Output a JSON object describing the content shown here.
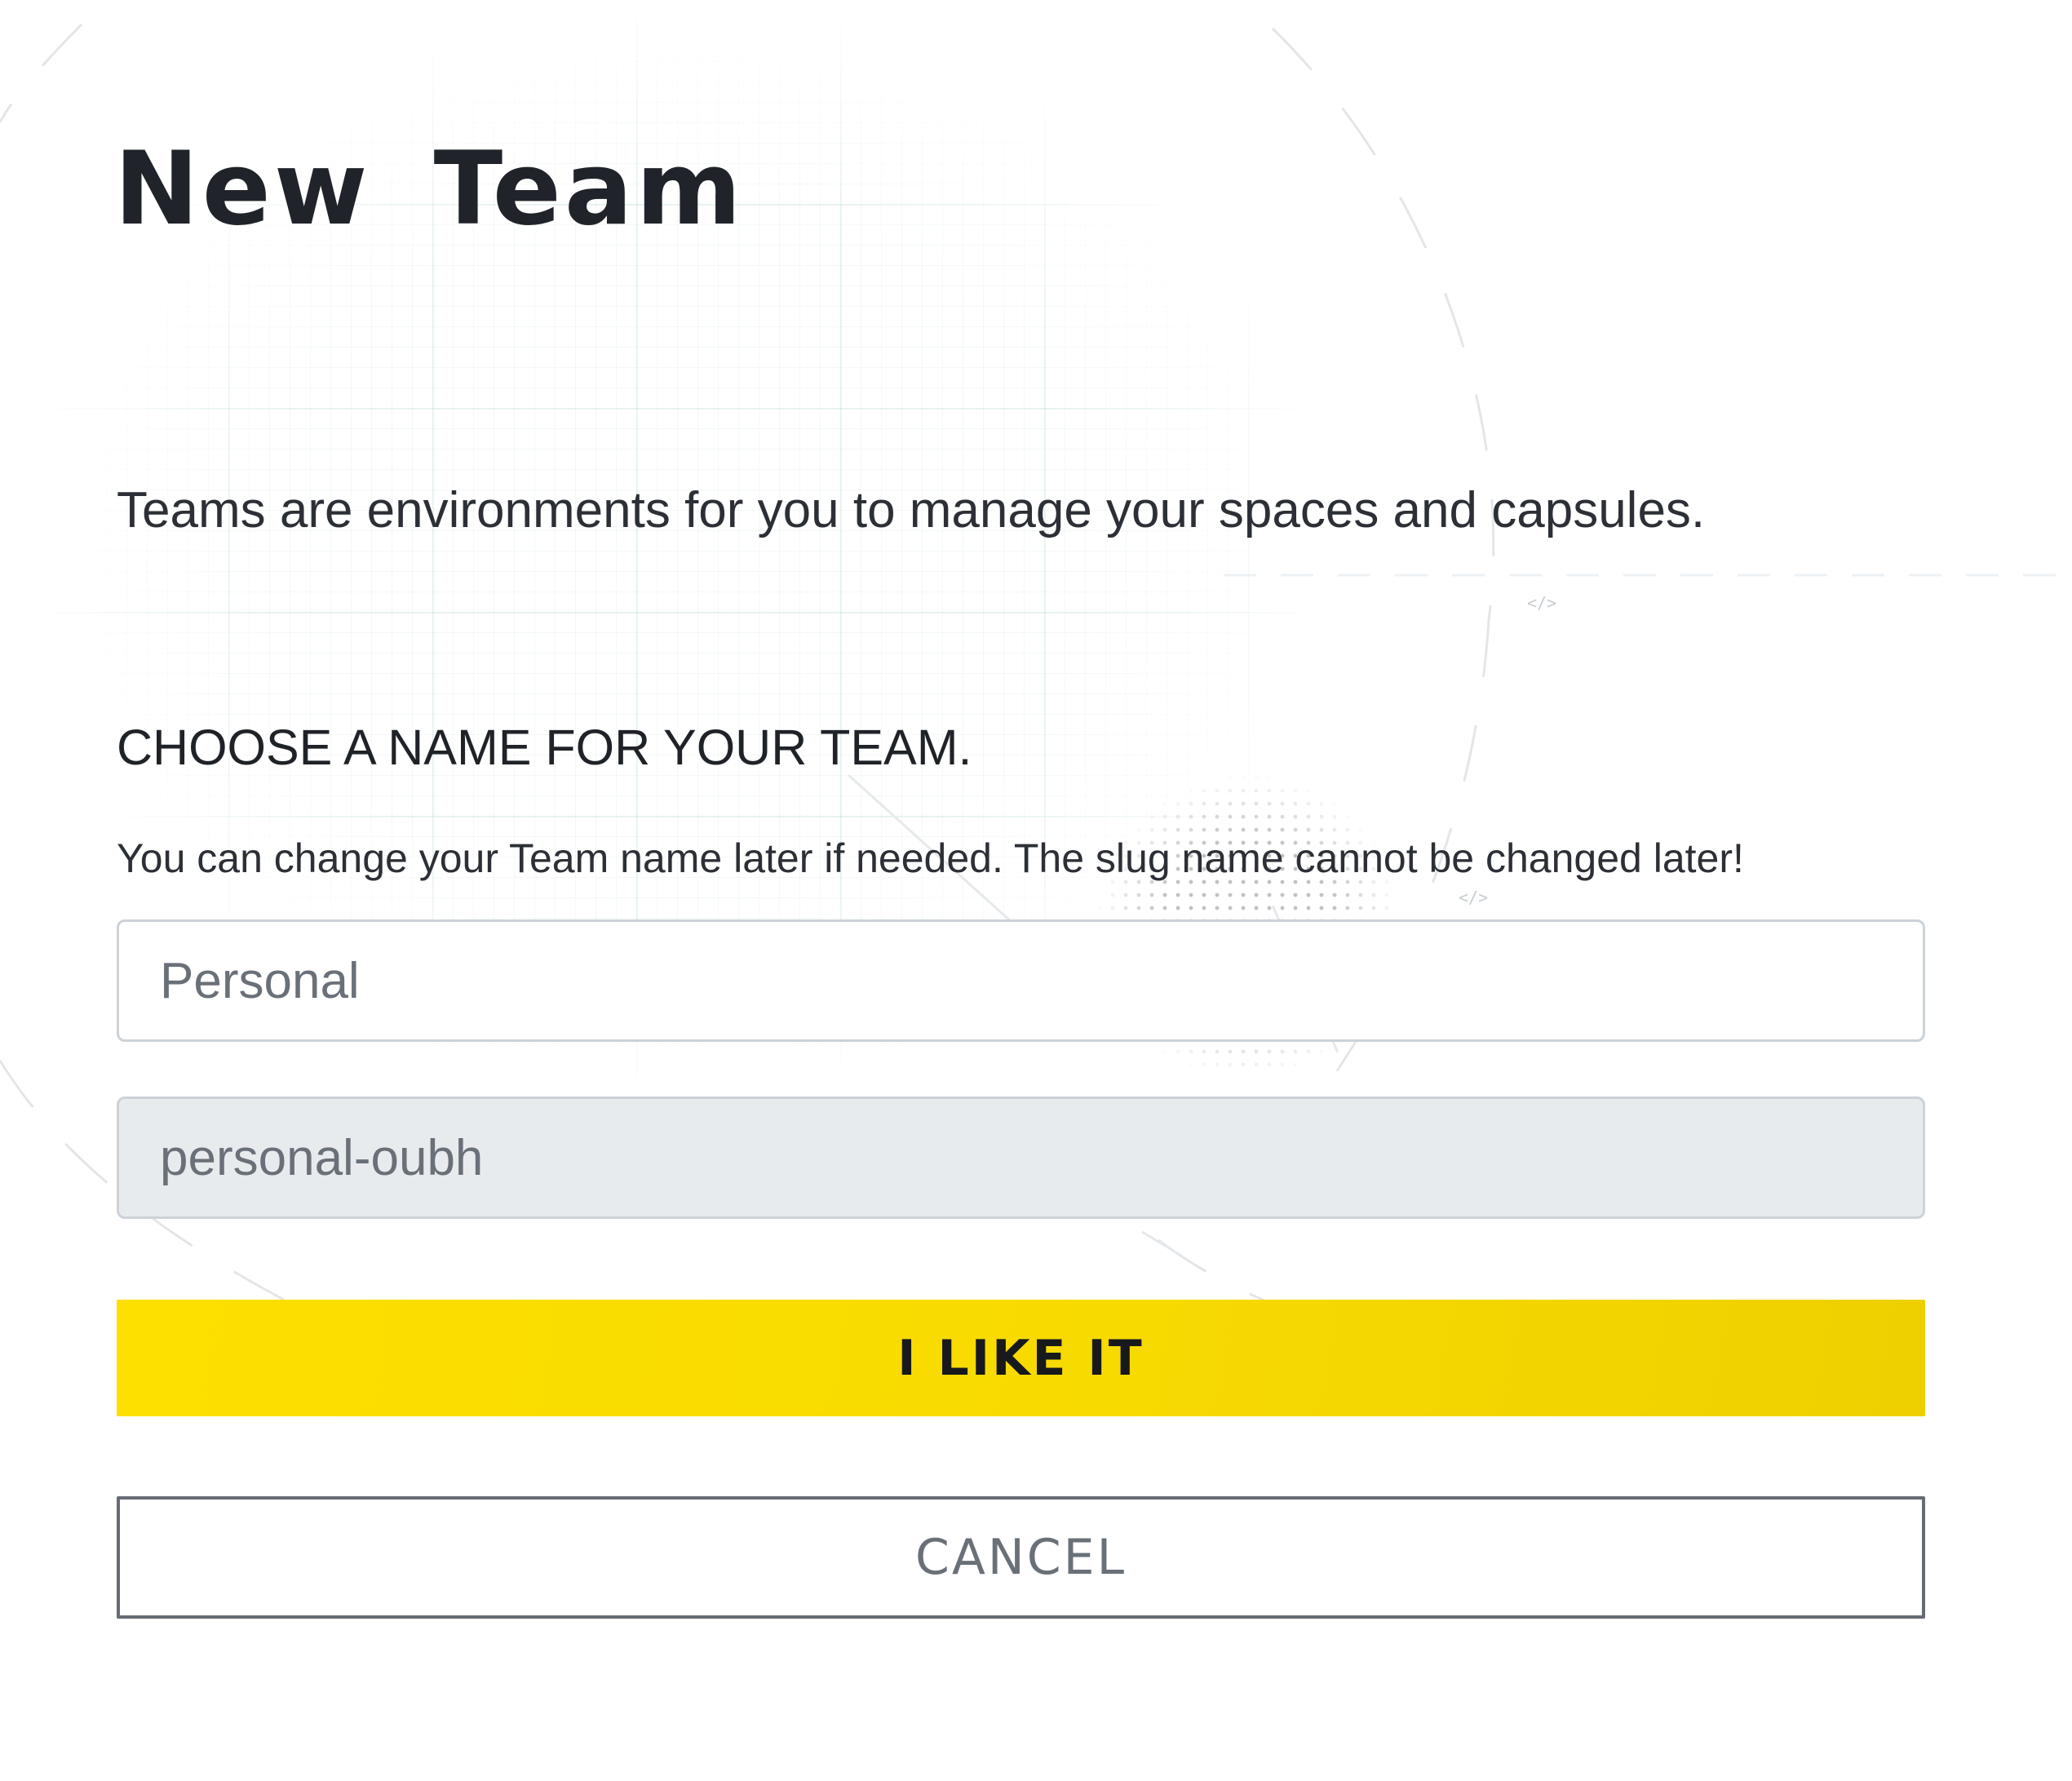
{
  "page": {
    "title": "New Team",
    "description": "Teams are environments for you to manage your spaces and capsules."
  },
  "team_form": {
    "heading": "CHOOSE A NAME FOR YOUR TEAM.",
    "help_text": "You can change your Team name later if needed. The slug name cannot be changed later!",
    "name_field": {
      "value": "",
      "placeholder": "Personal"
    },
    "slug_field": {
      "value": "",
      "placeholder": "personal-oubh",
      "disabled": true
    },
    "confirm_label": "I LIKE IT",
    "cancel_label": "CANCEL"
  },
  "decorations": {
    "code_tags": [
      "</>",
      "</>"
    ]
  },
  "colors": {
    "accent_yellow": "#fde000",
    "text_dark": "#20242a",
    "text_muted": "#6a7078",
    "disabled_field_bg": "#e8ebee",
    "field_border": "#ccd2d8",
    "cancel_border": "#666c73"
  }
}
